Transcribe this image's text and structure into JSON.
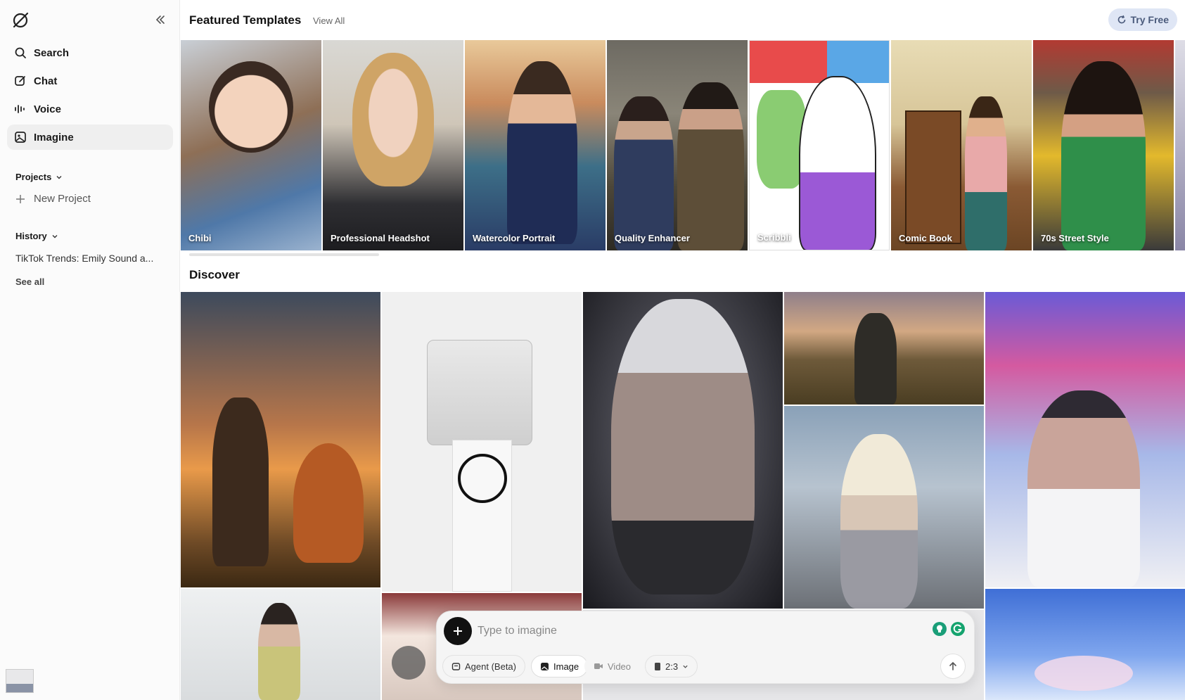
{
  "sidebar": {
    "items": [
      {
        "label": "Search",
        "icon": "search-icon"
      },
      {
        "label": "Chat",
        "icon": "chat-edit-icon"
      },
      {
        "label": "Voice",
        "icon": "voice-waveform-icon"
      },
      {
        "label": "Imagine",
        "icon": "image-icon",
        "active": true
      }
    ],
    "projects_label": "Projects",
    "new_project_label": "New Project",
    "history_label": "History",
    "history_items": [
      "TikTok Trends: Emily Sound a..."
    ],
    "see_all_label": "See all"
  },
  "header": {
    "featured_title": "Featured Templates",
    "view_all_label": "View All",
    "try_free_label": "Try Free"
  },
  "templates": [
    {
      "label": "Chibi"
    },
    {
      "label": "Professional Headshot"
    },
    {
      "label": "Watercolor Portrait"
    },
    {
      "label": "Quality Enhancer"
    },
    {
      "label": "Scribbli"
    },
    {
      "label": "Comic Book"
    },
    {
      "label": "70s Street Style"
    }
  ],
  "discover": {
    "title": "Discover"
  },
  "composer": {
    "placeholder": "Type to imagine",
    "agent_label": "Agent (Beta)",
    "image_label": "Image",
    "video_label": "Video",
    "ratio_label": "2:3"
  },
  "colors": {
    "accent": "#111111",
    "try_free_bg": "#dfe6f5",
    "active_nav_bg": "#efefef"
  }
}
